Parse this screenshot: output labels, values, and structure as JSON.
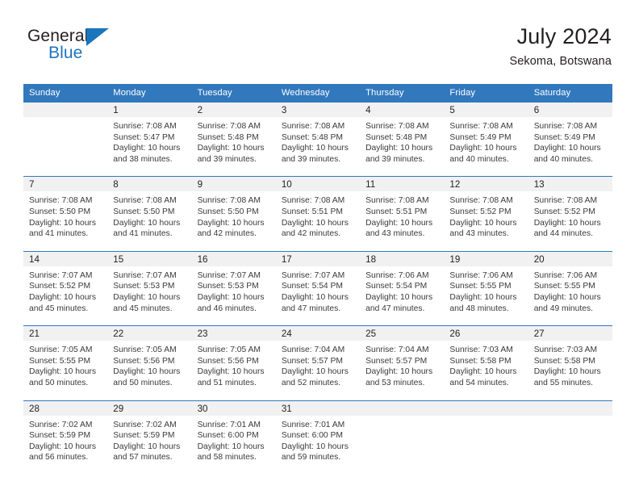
{
  "brand": {
    "name_part1": "General",
    "name_part2": "Blue",
    "triangle_color": "#1b75bc"
  },
  "header": {
    "title": "July 2024",
    "subtitle": "Sekoma, Botswana"
  },
  "theme": {
    "header_blue": "#3278bd",
    "daynum_band": "#f1f1f1",
    "text": "#231f20",
    "body_text": "#3a3a3a"
  },
  "weekday_headers": [
    "Sunday",
    "Monday",
    "Tuesday",
    "Wednesday",
    "Thursday",
    "Friday",
    "Saturday"
  ],
  "weeks": [
    [
      {
        "day": "",
        "sunrise": "",
        "sunset": "",
        "daylight1": "",
        "daylight2": "",
        "empty": true
      },
      {
        "day": "1",
        "sunrise": "Sunrise: 7:08 AM",
        "sunset": "Sunset: 5:47 PM",
        "daylight1": "Daylight: 10 hours",
        "daylight2": "and 38 minutes.",
        "empty": false
      },
      {
        "day": "2",
        "sunrise": "Sunrise: 7:08 AM",
        "sunset": "Sunset: 5:48 PM",
        "daylight1": "Daylight: 10 hours",
        "daylight2": "and 39 minutes.",
        "empty": false
      },
      {
        "day": "3",
        "sunrise": "Sunrise: 7:08 AM",
        "sunset": "Sunset: 5:48 PM",
        "daylight1": "Daylight: 10 hours",
        "daylight2": "and 39 minutes.",
        "empty": false
      },
      {
        "day": "4",
        "sunrise": "Sunrise: 7:08 AM",
        "sunset": "Sunset: 5:48 PM",
        "daylight1": "Daylight: 10 hours",
        "daylight2": "and 39 minutes.",
        "empty": false
      },
      {
        "day": "5",
        "sunrise": "Sunrise: 7:08 AM",
        "sunset": "Sunset: 5:49 PM",
        "daylight1": "Daylight: 10 hours",
        "daylight2": "and 40 minutes.",
        "empty": false
      },
      {
        "day": "6",
        "sunrise": "Sunrise: 7:08 AM",
        "sunset": "Sunset: 5:49 PM",
        "daylight1": "Daylight: 10 hours",
        "daylight2": "and 40 minutes.",
        "empty": false
      }
    ],
    [
      {
        "day": "7",
        "sunrise": "Sunrise: 7:08 AM",
        "sunset": "Sunset: 5:50 PM",
        "daylight1": "Daylight: 10 hours",
        "daylight2": "and 41 minutes.",
        "empty": false
      },
      {
        "day": "8",
        "sunrise": "Sunrise: 7:08 AM",
        "sunset": "Sunset: 5:50 PM",
        "daylight1": "Daylight: 10 hours",
        "daylight2": "and 41 minutes.",
        "empty": false
      },
      {
        "day": "9",
        "sunrise": "Sunrise: 7:08 AM",
        "sunset": "Sunset: 5:50 PM",
        "daylight1": "Daylight: 10 hours",
        "daylight2": "and 42 minutes.",
        "empty": false
      },
      {
        "day": "10",
        "sunrise": "Sunrise: 7:08 AM",
        "sunset": "Sunset: 5:51 PM",
        "daylight1": "Daylight: 10 hours",
        "daylight2": "and 42 minutes.",
        "empty": false
      },
      {
        "day": "11",
        "sunrise": "Sunrise: 7:08 AM",
        "sunset": "Sunset: 5:51 PM",
        "daylight1": "Daylight: 10 hours",
        "daylight2": "and 43 minutes.",
        "empty": false
      },
      {
        "day": "12",
        "sunrise": "Sunrise: 7:08 AM",
        "sunset": "Sunset: 5:52 PM",
        "daylight1": "Daylight: 10 hours",
        "daylight2": "and 43 minutes.",
        "empty": false
      },
      {
        "day": "13",
        "sunrise": "Sunrise: 7:08 AM",
        "sunset": "Sunset: 5:52 PM",
        "daylight1": "Daylight: 10 hours",
        "daylight2": "and 44 minutes.",
        "empty": false
      }
    ],
    [
      {
        "day": "14",
        "sunrise": "Sunrise: 7:07 AM",
        "sunset": "Sunset: 5:52 PM",
        "daylight1": "Daylight: 10 hours",
        "daylight2": "and 45 minutes.",
        "empty": false
      },
      {
        "day": "15",
        "sunrise": "Sunrise: 7:07 AM",
        "sunset": "Sunset: 5:53 PM",
        "daylight1": "Daylight: 10 hours",
        "daylight2": "and 45 minutes.",
        "empty": false
      },
      {
        "day": "16",
        "sunrise": "Sunrise: 7:07 AM",
        "sunset": "Sunset: 5:53 PM",
        "daylight1": "Daylight: 10 hours",
        "daylight2": "and 46 minutes.",
        "empty": false
      },
      {
        "day": "17",
        "sunrise": "Sunrise: 7:07 AM",
        "sunset": "Sunset: 5:54 PM",
        "daylight1": "Daylight: 10 hours",
        "daylight2": "and 47 minutes.",
        "empty": false
      },
      {
        "day": "18",
        "sunrise": "Sunrise: 7:06 AM",
        "sunset": "Sunset: 5:54 PM",
        "daylight1": "Daylight: 10 hours",
        "daylight2": "and 47 minutes.",
        "empty": false
      },
      {
        "day": "19",
        "sunrise": "Sunrise: 7:06 AM",
        "sunset": "Sunset: 5:55 PM",
        "daylight1": "Daylight: 10 hours",
        "daylight2": "and 48 minutes.",
        "empty": false
      },
      {
        "day": "20",
        "sunrise": "Sunrise: 7:06 AM",
        "sunset": "Sunset: 5:55 PM",
        "daylight1": "Daylight: 10 hours",
        "daylight2": "and 49 minutes.",
        "empty": false
      }
    ],
    [
      {
        "day": "21",
        "sunrise": "Sunrise: 7:05 AM",
        "sunset": "Sunset: 5:55 PM",
        "daylight1": "Daylight: 10 hours",
        "daylight2": "and 50 minutes.",
        "empty": false
      },
      {
        "day": "22",
        "sunrise": "Sunrise: 7:05 AM",
        "sunset": "Sunset: 5:56 PM",
        "daylight1": "Daylight: 10 hours",
        "daylight2": "and 50 minutes.",
        "empty": false
      },
      {
        "day": "23",
        "sunrise": "Sunrise: 7:05 AM",
        "sunset": "Sunset: 5:56 PM",
        "daylight1": "Daylight: 10 hours",
        "daylight2": "and 51 minutes.",
        "empty": false
      },
      {
        "day": "24",
        "sunrise": "Sunrise: 7:04 AM",
        "sunset": "Sunset: 5:57 PM",
        "daylight1": "Daylight: 10 hours",
        "daylight2": "and 52 minutes.",
        "empty": false
      },
      {
        "day": "25",
        "sunrise": "Sunrise: 7:04 AM",
        "sunset": "Sunset: 5:57 PM",
        "daylight1": "Daylight: 10 hours",
        "daylight2": "and 53 minutes.",
        "empty": false
      },
      {
        "day": "26",
        "sunrise": "Sunrise: 7:03 AM",
        "sunset": "Sunset: 5:58 PM",
        "daylight1": "Daylight: 10 hours",
        "daylight2": "and 54 minutes.",
        "empty": false
      },
      {
        "day": "27",
        "sunrise": "Sunrise: 7:03 AM",
        "sunset": "Sunset: 5:58 PM",
        "daylight1": "Daylight: 10 hours",
        "daylight2": "and 55 minutes.",
        "empty": false
      }
    ],
    [
      {
        "day": "28",
        "sunrise": "Sunrise: 7:02 AM",
        "sunset": "Sunset: 5:59 PM",
        "daylight1": "Daylight: 10 hours",
        "daylight2": "and 56 minutes.",
        "empty": false
      },
      {
        "day": "29",
        "sunrise": "Sunrise: 7:02 AM",
        "sunset": "Sunset: 5:59 PM",
        "daylight1": "Daylight: 10 hours",
        "daylight2": "and 57 minutes.",
        "empty": false
      },
      {
        "day": "30",
        "sunrise": "Sunrise: 7:01 AM",
        "sunset": "Sunset: 6:00 PM",
        "daylight1": "Daylight: 10 hours",
        "daylight2": "and 58 minutes.",
        "empty": false
      },
      {
        "day": "31",
        "sunrise": "Sunrise: 7:01 AM",
        "sunset": "Sunset: 6:00 PM",
        "daylight1": "Daylight: 10 hours",
        "daylight2": "and 59 minutes.",
        "empty": false
      },
      {
        "day": "",
        "sunrise": "",
        "sunset": "",
        "daylight1": "",
        "daylight2": "",
        "empty": true
      },
      {
        "day": "",
        "sunrise": "",
        "sunset": "",
        "daylight1": "",
        "daylight2": "",
        "empty": true
      },
      {
        "day": "",
        "sunrise": "",
        "sunset": "",
        "daylight1": "",
        "daylight2": "",
        "empty": true
      }
    ]
  ]
}
